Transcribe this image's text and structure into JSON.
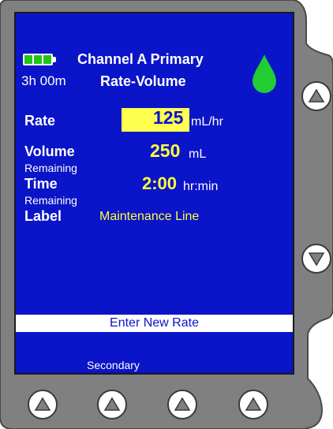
{
  "header": {
    "battery_time": "3h 00m",
    "channel_title": "Channel A Primary",
    "mode": "Rate-Volume"
  },
  "fields": {
    "rate_label": "Rate",
    "rate_value": "125",
    "rate_unit": "mL/hr",
    "volume_label": "Volume",
    "volume_sublabel": "Remaining",
    "volume_value": "250",
    "volume_unit": "mL",
    "time_label": "Time",
    "time_sublabel": "Remaining",
    "time_value": "2:00",
    "time_unit": "hr:min",
    "label_label": "Label",
    "label_value": "Maintenance Line"
  },
  "prompt": "Enter New Rate",
  "softkeys": {
    "secondary_label": "Secondary"
  },
  "colors": {
    "screen_bg": "#0a14c8",
    "value_yellow": "#ffff40",
    "highlight_yellow": "#ffff50",
    "battery_green": "#22c41a",
    "drop_green": "#22cc33",
    "bezel_gray": "#808080"
  },
  "icons": {
    "battery": "battery-icon",
    "drop": "fluid-drop-icon",
    "scroll_up": "arrow-up-icon",
    "scroll_down": "arrow-down-icon",
    "softkey": "arrow-up-icon"
  }
}
